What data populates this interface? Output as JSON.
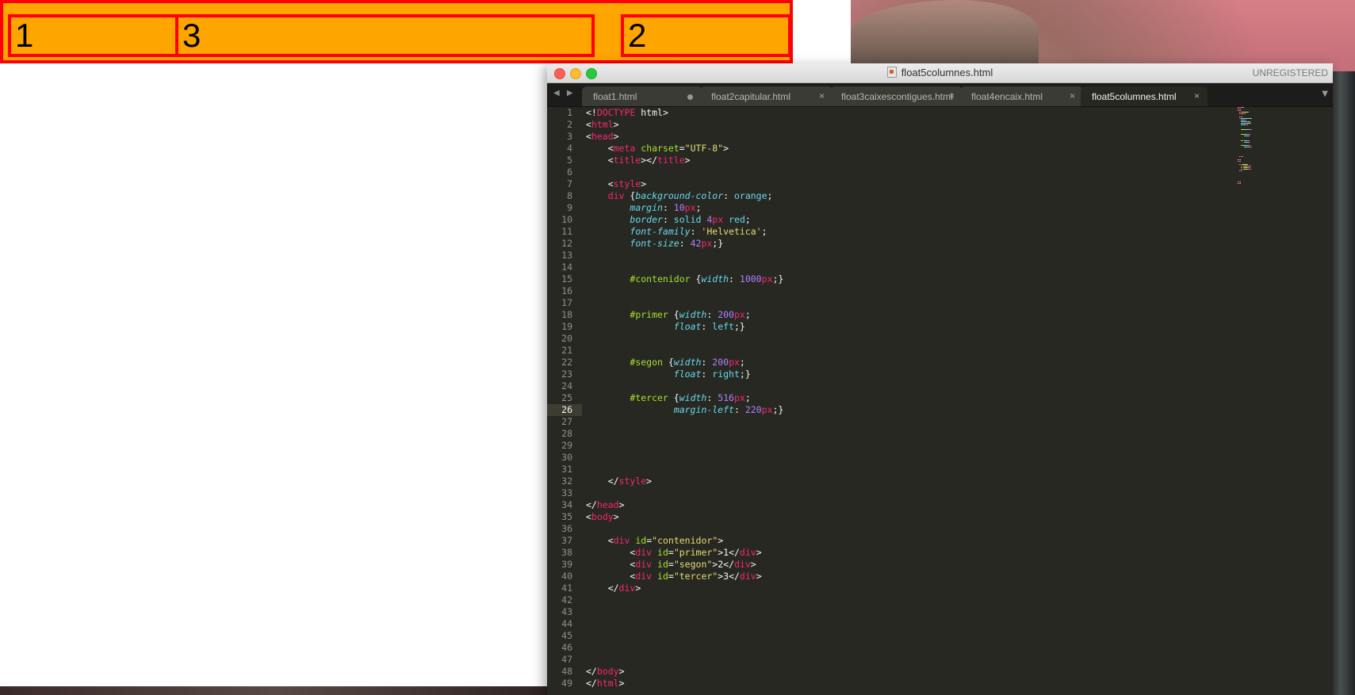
{
  "browser": {
    "boxes": {
      "primer": "1",
      "segon": "2",
      "tercer": "3"
    }
  },
  "editor": {
    "window_title": "float5columnes.html",
    "unregistered": "UNREGISTERED",
    "tabs": [
      {
        "label": "float1.html",
        "dirty": true,
        "active": false
      },
      {
        "label": "float2capitular.html",
        "dirty": false,
        "active": false
      },
      {
        "label": "float3caixescontigues.html",
        "dirty": false,
        "active": false
      },
      {
        "label": "float4encaix.html",
        "dirty": false,
        "active": false
      },
      {
        "label": "float5columnes.html",
        "dirty": false,
        "active": true
      }
    ],
    "current_line": 26,
    "lines": [
      [
        [
          "t",
          "<!"
        ],
        [
          "tag",
          "DOCTYPE"
        ],
        [
          "t",
          " html>"
        ]
      ],
      [
        [
          "t",
          "<"
        ],
        [
          "tag",
          "html"
        ],
        [
          "t",
          ">"
        ]
      ],
      [
        [
          "t",
          "<"
        ],
        [
          "tag",
          "head"
        ],
        [
          "t",
          ">"
        ]
      ],
      [
        [
          "t",
          "    <"
        ],
        [
          "tag",
          "meta"
        ],
        [
          "t",
          " "
        ],
        [
          "attr",
          "charset"
        ],
        [
          "t",
          "="
        ],
        [
          "str",
          "\"UTF-8\""
        ],
        [
          "t",
          ">"
        ]
      ],
      [
        [
          "t",
          "    <"
        ],
        [
          "tag",
          "title"
        ],
        [
          "t",
          "></"
        ],
        [
          "tag",
          "title"
        ],
        [
          "t",
          ">"
        ]
      ],
      [],
      [
        [
          "t",
          "    <"
        ],
        [
          "tag",
          "style"
        ],
        [
          "t",
          ">"
        ]
      ],
      [
        [
          "t",
          "    "
        ],
        [
          "tag",
          "div"
        ],
        [
          "t",
          " {"
        ],
        [
          "prop",
          "background-color"
        ],
        [
          "t",
          ": "
        ],
        [
          "kw",
          "orange"
        ],
        [
          "t",
          ";"
        ]
      ],
      [
        [
          "t",
          "        "
        ],
        [
          "prop",
          "margin"
        ],
        [
          "t",
          ": "
        ],
        [
          "num",
          "10"
        ],
        [
          "unit",
          "px"
        ],
        [
          "t",
          ";"
        ]
      ],
      [
        [
          "t",
          "        "
        ],
        [
          "prop",
          "border"
        ],
        [
          "t",
          ": "
        ],
        [
          "kw",
          "solid"
        ],
        [
          "t",
          " "
        ],
        [
          "num",
          "4"
        ],
        [
          "unit",
          "px"
        ],
        [
          "t",
          " "
        ],
        [
          "kw",
          "red"
        ],
        [
          "t",
          ";"
        ]
      ],
      [
        [
          "t",
          "        "
        ],
        [
          "prop",
          "font-family"
        ],
        [
          "t",
          ": "
        ],
        [
          "str",
          "'Helvetica'"
        ],
        [
          "t",
          ";"
        ]
      ],
      [
        [
          "t",
          "        "
        ],
        [
          "prop",
          "font-size"
        ],
        [
          "t",
          ": "
        ],
        [
          "num",
          "42"
        ],
        [
          "unit",
          "px"
        ],
        [
          "t",
          ";}"
        ]
      ],
      [],
      [],
      [
        [
          "t",
          "        "
        ],
        [
          "sel",
          "#contenidor"
        ],
        [
          "t",
          " {"
        ],
        [
          "prop",
          "width"
        ],
        [
          "t",
          ": "
        ],
        [
          "num",
          "1000"
        ],
        [
          "unit",
          "px"
        ],
        [
          "t",
          ";}"
        ]
      ],
      [],
      [],
      [
        [
          "t",
          "        "
        ],
        [
          "sel",
          "#primer"
        ],
        [
          "t",
          " {"
        ],
        [
          "prop",
          "width"
        ],
        [
          "t",
          ": "
        ],
        [
          "num",
          "200"
        ],
        [
          "unit",
          "px"
        ],
        [
          "t",
          ";"
        ]
      ],
      [
        [
          "t",
          "                "
        ],
        [
          "prop",
          "float"
        ],
        [
          "t",
          ": "
        ],
        [
          "kw",
          "left"
        ],
        [
          "t",
          ";}"
        ]
      ],
      [],
      [],
      [
        [
          "t",
          "        "
        ],
        [
          "sel",
          "#segon"
        ],
        [
          "t",
          " {"
        ],
        [
          "prop",
          "width"
        ],
        [
          "t",
          ": "
        ],
        [
          "num",
          "200"
        ],
        [
          "unit",
          "px"
        ],
        [
          "t",
          ";"
        ]
      ],
      [
        [
          "t",
          "                "
        ],
        [
          "prop",
          "float"
        ],
        [
          "t",
          ": "
        ],
        [
          "kw",
          "right"
        ],
        [
          "t",
          ";}"
        ]
      ],
      [],
      [
        [
          "t",
          "        "
        ],
        [
          "sel",
          "#tercer"
        ],
        [
          "t",
          " {"
        ],
        [
          "prop",
          "width"
        ],
        [
          "t",
          ": "
        ],
        [
          "num",
          "516"
        ],
        [
          "unit",
          "px"
        ],
        [
          "t",
          ";"
        ]
      ],
      [
        [
          "t",
          "                "
        ],
        [
          "prop",
          "margin-left"
        ],
        [
          "t",
          ": "
        ],
        [
          "num",
          "220"
        ],
        [
          "unit",
          "px"
        ],
        [
          "t",
          ";}"
        ]
      ],
      [],
      [],
      [],
      [],
      [],
      [
        [
          "t",
          "    </"
        ],
        [
          "tag",
          "style"
        ],
        [
          "t",
          ">"
        ]
      ],
      [],
      [
        [
          "t",
          "</"
        ],
        [
          "tag",
          "head"
        ],
        [
          "t",
          ">"
        ]
      ],
      [
        [
          "t",
          "<"
        ],
        [
          "tag",
          "body"
        ],
        [
          "t",
          ">"
        ]
      ],
      [],
      [
        [
          "t",
          "    <"
        ],
        [
          "tag",
          "div"
        ],
        [
          "t",
          " "
        ],
        [
          "attr",
          "id"
        ],
        [
          "t",
          "="
        ],
        [
          "str",
          "\"contenidor\""
        ],
        [
          "t",
          ">"
        ]
      ],
      [
        [
          "t",
          "        <"
        ],
        [
          "tag",
          "div"
        ],
        [
          "t",
          " "
        ],
        [
          "attr",
          "id"
        ],
        [
          "t",
          "="
        ],
        [
          "str",
          "\"primer\""
        ],
        [
          "t",
          ">1</"
        ],
        [
          "tag",
          "div"
        ],
        [
          "t",
          ">"
        ]
      ],
      [
        [
          "t",
          "        <"
        ],
        [
          "tag",
          "div"
        ],
        [
          "t",
          " "
        ],
        [
          "attr",
          "id"
        ],
        [
          "t",
          "="
        ],
        [
          "str",
          "\"segon\""
        ],
        [
          "t",
          ">2</"
        ],
        [
          "tag",
          "div"
        ],
        [
          "t",
          ">"
        ]
      ],
      [
        [
          "t",
          "        <"
        ],
        [
          "tag",
          "div"
        ],
        [
          "t",
          " "
        ],
        [
          "attr",
          "id"
        ],
        [
          "t",
          "="
        ],
        [
          "str",
          "\"tercer\""
        ],
        [
          "t",
          ">3</"
        ],
        [
          "tag",
          "div"
        ],
        [
          "t",
          ">"
        ]
      ],
      [
        [
          "t",
          "    </"
        ],
        [
          "tag",
          "div"
        ],
        [
          "t",
          ">"
        ]
      ],
      [],
      [],
      [],
      [],
      [],
      [],
      [
        [
          "t",
          "</"
        ],
        [
          "tag",
          "body"
        ],
        [
          "t",
          ">"
        ]
      ],
      [
        [
          "t",
          "</"
        ],
        [
          "tag",
          "html"
        ],
        [
          "t",
          ">"
        ]
      ]
    ]
  }
}
